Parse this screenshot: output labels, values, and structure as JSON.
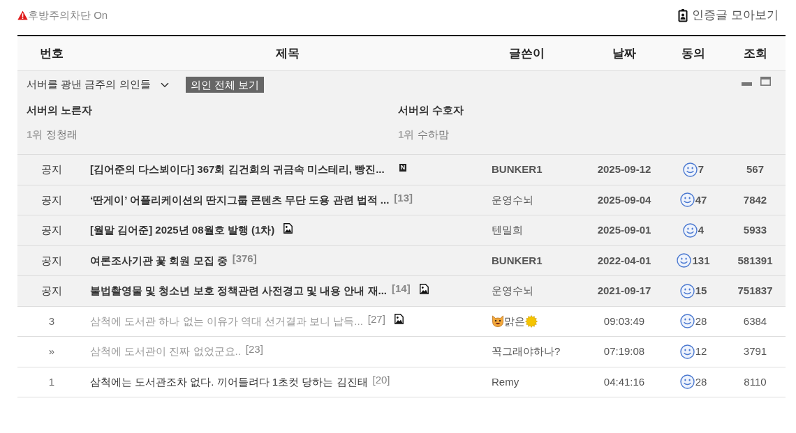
{
  "top_bar": {
    "filter_label": "후방주의차단 On",
    "verified_link": "인증글 모아보기"
  },
  "table": {
    "columns": [
      "번호",
      "제목",
      "글쓴이",
      "날짜",
      "동의",
      "조회"
    ],
    "featured_panel": {
      "title": "서버를 광낸 금주의 의인들",
      "view_all_button": "의인 전체 보기",
      "sections": [
        {
          "title": "서버의 노른자",
          "entries": [
            {
              "rank": "1위",
              "name": "정청래"
            }
          ]
        },
        {
          "title": "서버의 수호자",
          "entries": [
            {
              "rank": "1위",
              "name": "수하맘"
            }
          ]
        }
      ]
    },
    "rows": [
      {
        "kind": "notice",
        "number": "공지",
        "title": "[김어준의 다스뵈이다] 367회 김건희의 귀금속 미스테리, 빵진...",
        "badge": "N",
        "image_attached": false,
        "read": false,
        "author": {
          "kind": "highlight",
          "name": "BUNKER1"
        },
        "date": "2025-09-12",
        "votes": "7",
        "views": "567"
      },
      {
        "kind": "notice",
        "number": "공지",
        "title": "‘딴게이’ 어플리케이션의 딴지그룹 콘텐츠 무단 도용 관련 법적 ...",
        "comments": "[13]",
        "image_attached": false,
        "read": false,
        "author": {
          "kind": "plain",
          "name": "운영수뇌"
        },
        "date": "2025-09-04",
        "votes": "47",
        "views": "7842"
      },
      {
        "kind": "notice",
        "number": "공지",
        "title": "[월말 김어준] 2025년 08월호 발행 (1차)",
        "image_attached": true,
        "read": false,
        "author": {
          "kind": "plain",
          "name": "텐밀희"
        },
        "date": "2025-09-01",
        "votes": "4",
        "views": "5933"
      },
      {
        "kind": "notice",
        "number": "공지",
        "title": "여론조사기관 꽃 회원 모집 중",
        "comments": "[376]",
        "image_attached": false,
        "read": false,
        "author": {
          "kind": "highlight",
          "name": "BUNKER1"
        },
        "date": "2022-04-01",
        "votes": "131",
        "views": "581391"
      },
      {
        "kind": "notice",
        "number": "공지",
        "title": "불법촬영물 및 청소년 보호 정책관련 사전경고 및 내용 안내 재...",
        "comments": "[14]",
        "image_attached": true,
        "read": false,
        "author": {
          "kind": "plain",
          "name": "운영수뇌"
        },
        "date": "2021-09-17",
        "votes": "15",
        "views": "751837"
      },
      {
        "kind": "post",
        "number": "3",
        "title": "삼척에 도서관 하나 없는 이유가 역대 선거결과 보니 납득...",
        "comments": "[27]",
        "image_attached": true,
        "read": true,
        "author": {
          "kind": "decorated",
          "name": "맑은"
        },
        "date": "09:03:49",
        "votes": "28",
        "views": "6384"
      },
      {
        "kind": "post",
        "number": "»",
        "title": "삼척에 도서관이 진짜 없었군요..",
        "comments": "[23]",
        "image_attached": false,
        "read": true,
        "author": {
          "kind": "plain",
          "name": "꼭그래야하나?"
        },
        "date": "07:19:08",
        "votes": "12",
        "views": "3791"
      },
      {
        "kind": "post",
        "number": "1",
        "title": "삼척에는 도서관조차 없다. 끼어들려다 1초컷 당하는 김진태",
        "comments": "[20]",
        "image_attached": false,
        "read": false,
        "author": {
          "kind": "plain",
          "name": "Remy"
        },
        "date": "04:41:16",
        "votes": "28",
        "views": "8110"
      }
    ]
  }
}
